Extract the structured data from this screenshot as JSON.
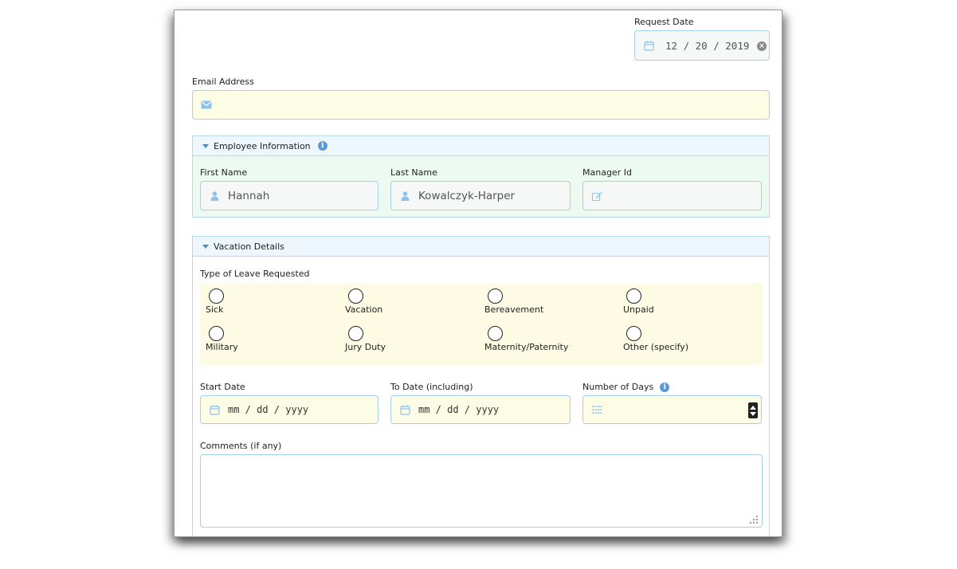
{
  "request_date": {
    "label": "Request Date",
    "month": "12",
    "day": "20",
    "year": "2019"
  },
  "email": {
    "label": "Email Address",
    "value": ""
  },
  "employee_info": {
    "title": "Employee Information",
    "first_name": {
      "label": "First Name",
      "value": "Hannah"
    },
    "last_name": {
      "label": "Last Name",
      "value": "Kowalczyk-Harper"
    },
    "manager_id": {
      "label": "Manager Id",
      "value": ""
    }
  },
  "vacation_details": {
    "title": "Vacation Details",
    "leave_type_label": "Type of Leave Requested",
    "leave_options": [
      "Sick",
      "Vacation",
      "Bereavement",
      "Unpaid",
      "Military",
      "Jury Duty",
      "Maternity/Paternity",
      "Other (specify)"
    ],
    "start_date": {
      "label": "Start Date",
      "placeholder": "mm / dd / yyyy"
    },
    "to_date": {
      "label": "To Date (including)",
      "placeholder": "mm / dd / yyyy"
    },
    "number_of_days": {
      "label": "Number of Days",
      "value": ""
    },
    "comments": {
      "label": "Comments (if any)",
      "value": ""
    }
  },
  "colors": {
    "field_border": "#a8cfe8",
    "yellow_fill": "#fdfde6",
    "green_panel": "#ecfaf1",
    "icon_blue": "#8ec3ee",
    "accent_blue": "#3f8fd2"
  }
}
